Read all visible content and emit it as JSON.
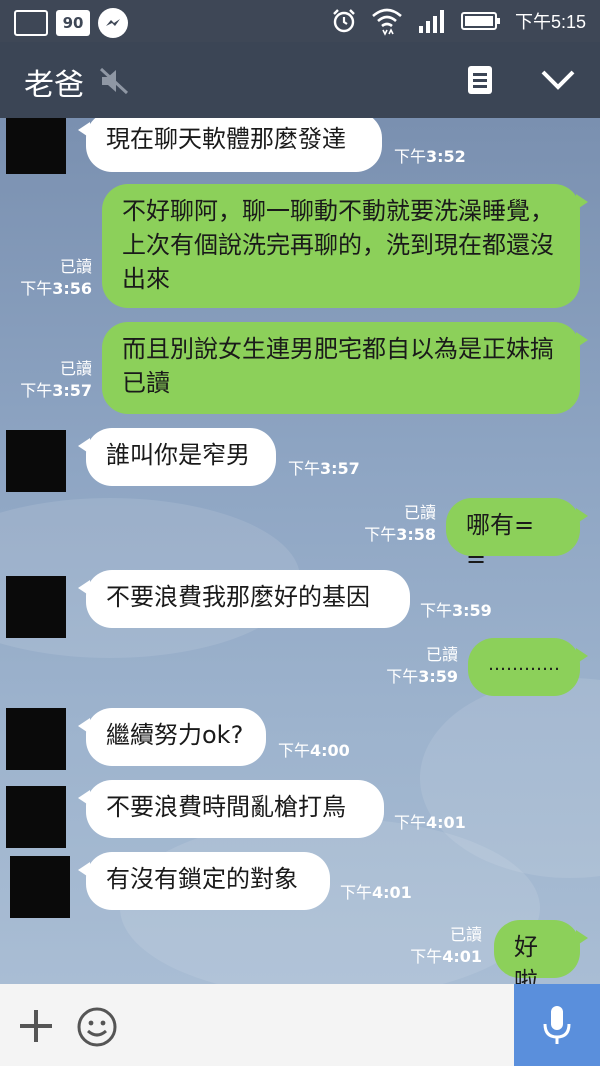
{
  "status_bar": {
    "badge": "90",
    "time": "下午5:15",
    "icons": [
      "gallery-icon",
      "messenger-icon",
      "alarm-icon",
      "wifi-icon",
      "signal-icon",
      "battery-icon"
    ]
  },
  "header": {
    "title": "老爸",
    "icons": [
      "mute-icon",
      "memo-icon",
      "chevron-down-icon"
    ]
  },
  "messages": [
    {
      "dir": "in",
      "text": "現在聊天軟體那麼發達",
      "time_prefix": "下午",
      "time": "3:52"
    },
    {
      "dir": "out",
      "read": "已讀",
      "text": "不好聊阿，聊一聊動不動就要洗澡睡覺，上次有個說洗完再聊的，洗到現在都還沒出來",
      "time_prefix": "下午",
      "time": "3:56"
    },
    {
      "dir": "out",
      "read": "已讀",
      "text": "而且別說女生連男肥宅都自以為是正妹搞已讀",
      "time_prefix": "下午",
      "time": "3:57"
    },
    {
      "dir": "in",
      "text": "誰叫你是窄男",
      "time_prefix": "下午",
      "time": "3:57"
    },
    {
      "dir": "out",
      "read": "已讀",
      "text": "哪有= =",
      "time_prefix": "下午",
      "time": "3:58"
    },
    {
      "dir": "in",
      "text": "不要浪費我那麼好的基因",
      "time_prefix": "下午",
      "time": "3:59"
    },
    {
      "dir": "out",
      "read": "已讀",
      "text": "…………",
      "time_prefix": "下午",
      "time": "3:59"
    },
    {
      "dir": "in",
      "text": "繼續努力ok?",
      "time_prefix": "下午",
      "time": "4:00"
    },
    {
      "dir": "in",
      "text": "不要浪費時間亂槍打鳥",
      "time_prefix": "下午",
      "time": "4:01"
    },
    {
      "dir": "in",
      "text": "有沒有鎖定的對象",
      "time_prefix": "下午",
      "time": "4:01"
    },
    {
      "dir": "out",
      "read": "已讀",
      "text": "好啦",
      "time_prefix": "下午",
      "time": "4:01"
    }
  ],
  "bottom_bar": {
    "icons": [
      "plus-icon",
      "emoji-icon",
      "microphone-icon"
    ]
  },
  "colors": {
    "header_bg": "#3b4555",
    "outgoing_bubble": "#8cd05a",
    "incoming_bubble": "#ffffff",
    "mic_button": "#5a8fdc"
  }
}
